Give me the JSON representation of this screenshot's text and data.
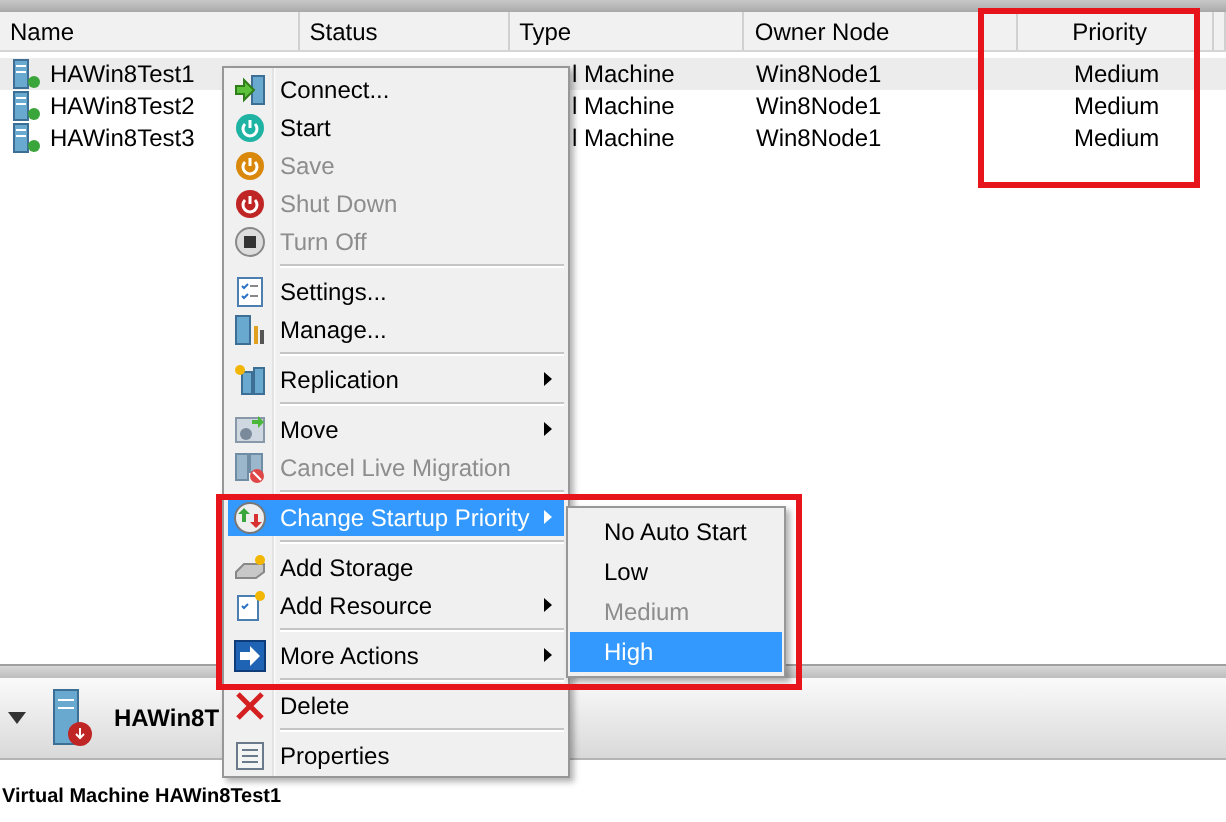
{
  "columns": [
    "Name",
    "Status",
    "Type",
    "Owner Node",
    "Priority"
  ],
  "rows": [
    {
      "name": "HAWin8Test1",
      "type": "l Machine",
      "owner_node": "Win8Node1",
      "priority": "Medium",
      "selected": true
    },
    {
      "name": "HAWin8Test2",
      "type": "l Machine",
      "owner_node": "Win8Node1",
      "priority": "Medium",
      "selected": false
    },
    {
      "name": "HAWin8Test3",
      "type": "l Machine",
      "owner_node": "Win8Node1",
      "priority": "Medium",
      "selected": false
    }
  ],
  "context_menu": {
    "items": [
      {
        "kind": "item",
        "label": "Connect...",
        "disabled": false,
        "submenu": false,
        "selected": false
      },
      {
        "kind": "item",
        "label": "Start",
        "disabled": false,
        "submenu": false,
        "selected": false
      },
      {
        "kind": "item",
        "label": "Save",
        "disabled": true,
        "submenu": false,
        "selected": false
      },
      {
        "kind": "item",
        "label": "Shut Down",
        "disabled": true,
        "submenu": false,
        "selected": false
      },
      {
        "kind": "item",
        "label": "Turn Off",
        "disabled": true,
        "submenu": false,
        "selected": false
      },
      {
        "kind": "separator"
      },
      {
        "kind": "item",
        "label": "Settings...",
        "disabled": false,
        "submenu": false,
        "selected": false
      },
      {
        "kind": "item",
        "label": "Manage...",
        "disabled": false,
        "submenu": false,
        "selected": false
      },
      {
        "kind": "separator"
      },
      {
        "kind": "item",
        "label": "Replication",
        "disabled": false,
        "submenu": true,
        "selected": false
      },
      {
        "kind": "separator"
      },
      {
        "kind": "item",
        "label": "Move",
        "disabled": false,
        "submenu": true,
        "selected": false
      },
      {
        "kind": "item",
        "label": "Cancel Live Migration",
        "disabled": true,
        "submenu": false,
        "selected": false
      },
      {
        "kind": "separator"
      },
      {
        "kind": "item",
        "label": "Change Startup Priority",
        "disabled": false,
        "submenu": true,
        "selected": true
      },
      {
        "kind": "separator"
      },
      {
        "kind": "item",
        "label": "Add Storage",
        "disabled": false,
        "submenu": false,
        "selected": false
      },
      {
        "kind": "item",
        "label": "Add Resource",
        "disabled": false,
        "submenu": true,
        "selected": false
      },
      {
        "kind": "separator"
      },
      {
        "kind": "item",
        "label": "More Actions",
        "disabled": false,
        "submenu": true,
        "selected": false
      },
      {
        "kind": "separator"
      },
      {
        "kind": "item",
        "label": "Delete",
        "disabled": false,
        "submenu": false,
        "selected": false
      },
      {
        "kind": "separator"
      },
      {
        "kind": "item",
        "label": "Properties",
        "disabled": false,
        "submenu": false,
        "selected": false
      }
    ]
  },
  "submenu": {
    "items": [
      {
        "label": "No Auto Start",
        "disabled": false,
        "selected": false
      },
      {
        "label": "Low",
        "disabled": false,
        "selected": false
      },
      {
        "label": "Medium",
        "disabled": true,
        "selected": false
      },
      {
        "label": "High",
        "disabled": false,
        "selected": true
      }
    ]
  },
  "details_panel": {
    "title": "HAWin8T",
    "subtitle": "Virtual Machine HAWin8Test1"
  }
}
